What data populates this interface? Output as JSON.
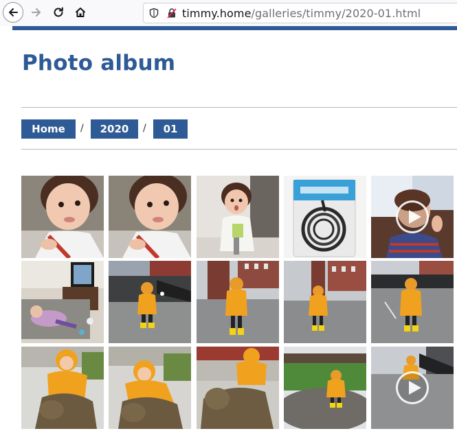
{
  "browser": {
    "url_host": "timmy.home",
    "url_path": "/galleries/timmy/2020-01.html",
    "icons": [
      "back-arrow-icon",
      "forward-arrow-icon",
      "reload-icon",
      "home-icon",
      "shield-icon",
      "insecure-lock-icon"
    ]
  },
  "page": {
    "title": "Photo album",
    "accent_color": "#2e5a95"
  },
  "breadcrumb": {
    "items": [
      {
        "label": "Home"
      },
      {
        "label": "2020"
      },
      {
        "label": "01"
      }
    ],
    "separator": "/"
  },
  "gallery": {
    "items": [
      {
        "name": "photo-girl-closeup",
        "type": "photo"
      },
      {
        "name": "photo-girl-closeup-2",
        "type": "photo"
      },
      {
        "name": "photo-girl-kitchen",
        "type": "photo"
      },
      {
        "name": "photo-cable-package",
        "type": "photo"
      },
      {
        "name": "video-boy-couch",
        "type": "video"
      },
      {
        "name": "photo-child-on-rug",
        "type": "photo"
      },
      {
        "name": "photo-child-rain-1",
        "type": "photo"
      },
      {
        "name": "photo-child-rain-2",
        "type": "photo"
      },
      {
        "name": "photo-child-rain-3",
        "type": "photo"
      },
      {
        "name": "photo-child-rain-4",
        "type": "photo"
      },
      {
        "name": "photo-child-bear-statue-1",
        "type": "photo"
      },
      {
        "name": "photo-child-bear-statue-2",
        "type": "photo"
      },
      {
        "name": "photo-child-bear-statue-3",
        "type": "photo"
      },
      {
        "name": "photo-child-puddle-park",
        "type": "photo"
      },
      {
        "name": "video-child-walkway",
        "type": "video"
      }
    ]
  }
}
